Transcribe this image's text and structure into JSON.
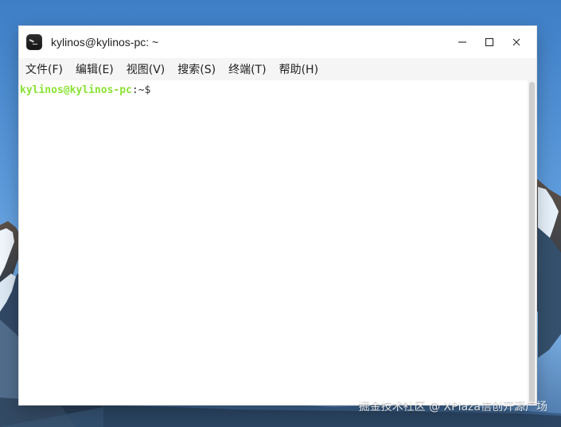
{
  "window": {
    "title": "kylinos@kylinos-pc: ~",
    "controls": {
      "minimize_icon": "minimize-icon",
      "maximize_icon": "maximize-icon",
      "close_icon": "close-icon"
    }
  },
  "menu": {
    "items": [
      {
        "label": "文件(F)"
      },
      {
        "label": "编辑(E)"
      },
      {
        "label": "视图(V)"
      },
      {
        "label": "搜索(S)"
      },
      {
        "label": "终端(T)"
      },
      {
        "label": "帮助(H)"
      }
    ]
  },
  "terminal": {
    "prompt_user_host": "kylinos@kylinos-pc",
    "prompt_separator": ":",
    "prompt_directory": "~",
    "prompt_symbol": "$"
  },
  "desktop": {
    "watermark": "掘金技术社区 @ XPlaza信创开源广场"
  },
  "colors": {
    "prompt_user": "#8ae234",
    "menubar_bg": "#f5f5f5",
    "desktop_sky": "#4b8bd0"
  }
}
